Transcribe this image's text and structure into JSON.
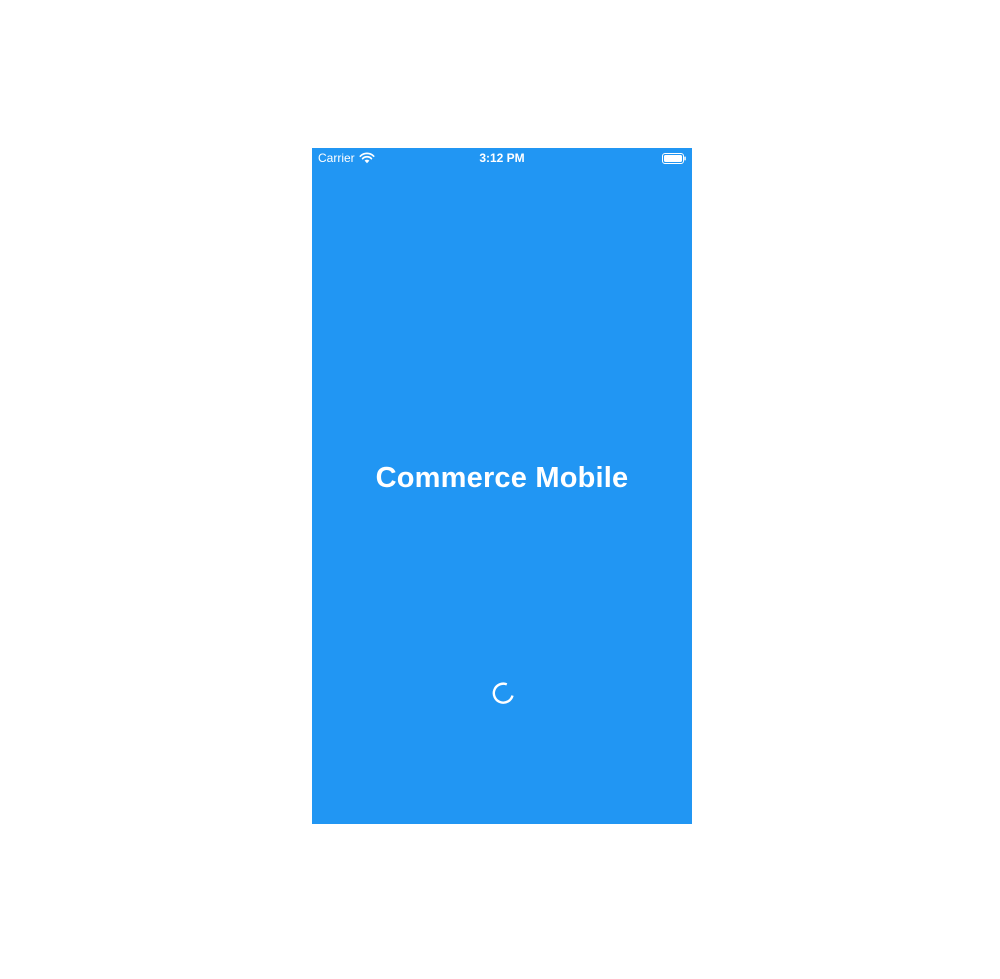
{
  "status_bar": {
    "carrier": "Carrier",
    "time": "3:12 PM",
    "wifi_icon": "wifi-icon",
    "battery_icon": "battery-full-icon"
  },
  "splash": {
    "title": "Commerce Mobile",
    "loading_indicator": "loading-spinner-icon"
  },
  "colors": {
    "background": "#2196F3",
    "foreground": "#FFFFFF",
    "page_background": "#FFFFFF"
  }
}
